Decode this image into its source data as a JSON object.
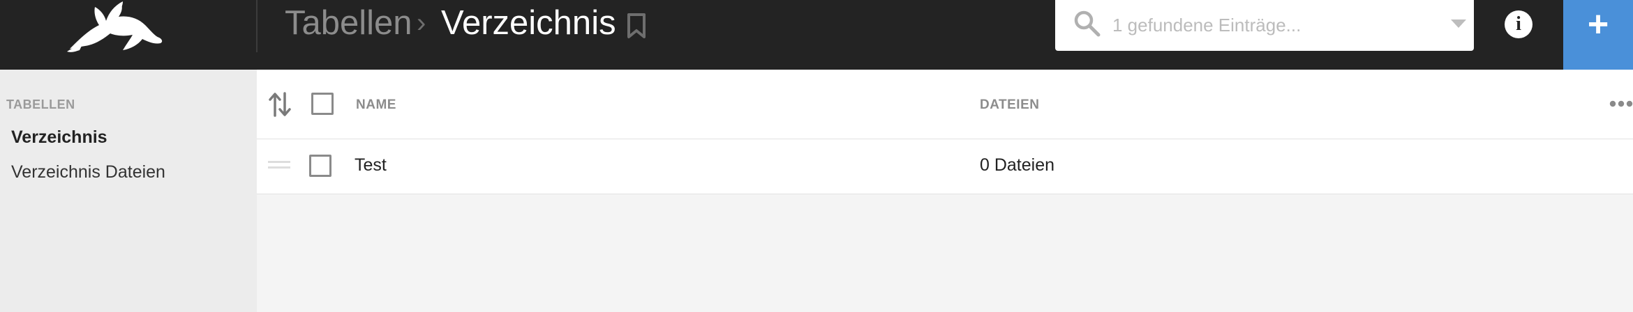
{
  "header": {
    "breadcrumb_parent": "Tabellen",
    "breadcrumb_separator": "›",
    "breadcrumb_current": "Verzeichnis",
    "search_placeholder": "1 gefundene Einträge...",
    "info_label": "i",
    "add_label": "+"
  },
  "sidebar": {
    "heading": "TABELLEN",
    "items": [
      {
        "label": "Verzeichnis",
        "active": true
      },
      {
        "label": "Verzeichnis Dateien",
        "active": false
      }
    ]
  },
  "table": {
    "columns": [
      "NAME",
      "DATEIEN"
    ],
    "rows": [
      {
        "name": "Test",
        "files": "0 Dateien"
      }
    ]
  },
  "icons": [
    "logo-rabbit-icon",
    "bookmark-icon",
    "search-icon",
    "chevron-down-icon",
    "info-icon",
    "plus-icon",
    "sort-icon",
    "more-icon",
    "drag-handle-icon"
  ],
  "colors": {
    "topbar": "#232323",
    "accent": "#4a90d9",
    "sidebar": "#ececec",
    "content": "#f4f4f4"
  }
}
